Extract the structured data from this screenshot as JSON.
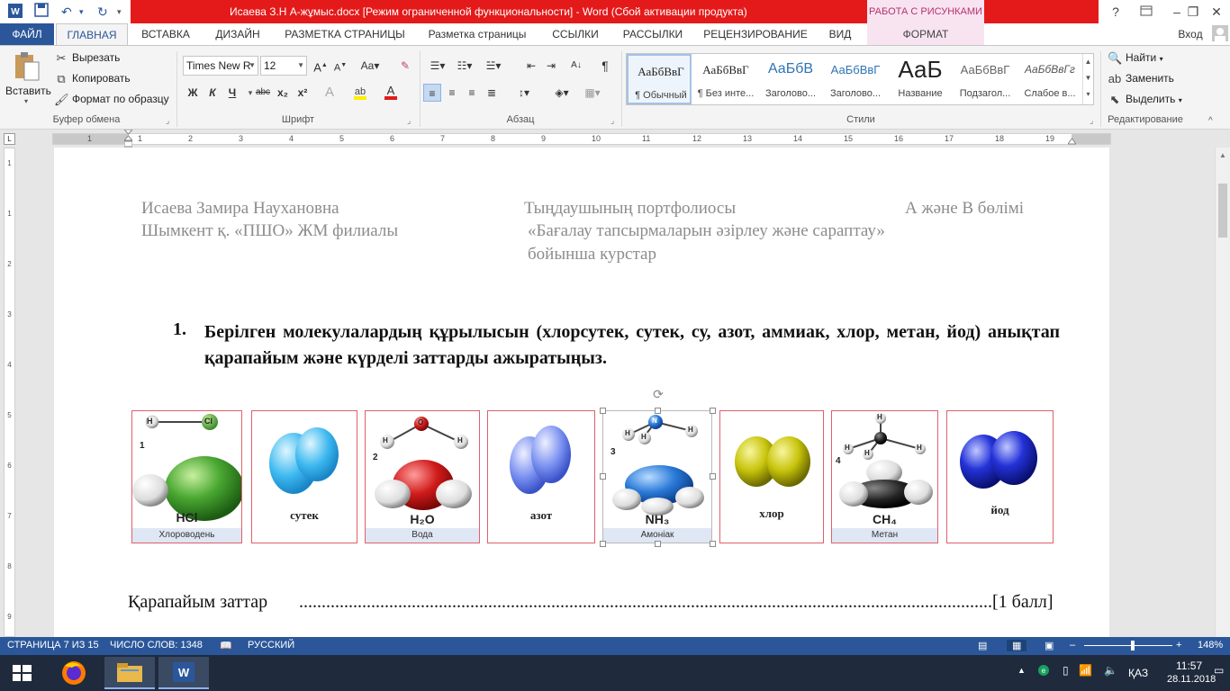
{
  "window": {
    "title": "Исаева З.Н   А-жұмыс.docx [Режим ограниченной функциональности]  -  Word (Сбой активации продукта)",
    "context_tab_group": "РАБОТА С РИСУНКАМИ",
    "help": "?",
    "accent_color": "#2b579a",
    "title_bg_color": "#e41a1a"
  },
  "tabs": {
    "file": "ФАЙЛ",
    "home": "ГЛАВНАЯ",
    "insert": "ВСТАВКА",
    "design": "ДИЗАЙН",
    "page_layout": "РАЗМЕТКА СТРАНИЦЫ",
    "page_layout2": "Разметка страницы",
    "references": "ССЫЛКИ",
    "mailings": "РАССЫЛКИ",
    "review": "РЕЦЕНЗИРОВАНИЕ",
    "view": "ВИД",
    "format": "ФОРМАТ",
    "signin": "Вход"
  },
  "ribbon": {
    "clipboard": {
      "paste": "Вставить",
      "cut": "Вырезать",
      "copy": "Копировать",
      "format_painter": "Формат по образцу",
      "label": "Буфер обмена"
    },
    "font": {
      "font_name": "Times New R",
      "font_size": "12",
      "bold": "Ж",
      "italic": "К",
      "underline": "Ч",
      "strike": "abc",
      "subscript": "x₂",
      "superscript": "x²",
      "label": "Шрифт"
    },
    "paragraph": {
      "label": "Абзац"
    },
    "styles": {
      "label": "Стили",
      "items": [
        {
          "sample": "АаБбВвГ",
          "name": "¶ Обычный"
        },
        {
          "sample": "АаБбВвГ",
          "name": "¶ Без инте..."
        },
        {
          "sample": "АаБбВ",
          "name": "Заголово..."
        },
        {
          "sample": "АаБбВвГ",
          "name": "Заголово..."
        },
        {
          "sample": "АаБ",
          "name": "Название"
        },
        {
          "sample": "АаБбВвГ",
          "name": "Подзагол..."
        },
        {
          "sample": "АаБбВвГг",
          "name": "Слабое в..."
        }
      ]
    },
    "editing": {
      "find": "Найти",
      "replace": "Заменить",
      "select": "Выделить",
      "label": "Редактирование"
    }
  },
  "ruler": {
    "h_numbers": [
      "1",
      "1",
      "2",
      "3",
      "4",
      "5",
      "6",
      "7",
      "8",
      "9",
      "10",
      "11",
      "12",
      "13",
      "14",
      "15",
      "16",
      "17",
      "18",
      "19"
    ],
    "v_numbers": [
      "1",
      "1",
      "2",
      "3",
      "4",
      "5",
      "6",
      "7",
      "8",
      "9"
    ]
  },
  "document": {
    "header": {
      "left_line1": "Исаева Замира Наухановна",
      "left_line2": "Шымкент қ. «ПШО» ЖМ филиалы",
      "center_line1": "Тыңдаушының портфолиосы",
      "center_line2": "«Бағалау тапсырмаларын әзірлеу және сараптау»",
      "center_line3": "бойынша курстар",
      "right_line1": "А және В бөлімі"
    },
    "question": {
      "number": "1.",
      "text": "Берілген молекулалардың құрылысын (хлорсутек, сутек, су, азот, аммиак, хлор, метан, йод) анықтап қарапайым және күрделі заттарды ажыратыңыз."
    },
    "molecules": [
      {
        "caption": "HCl",
        "subcaption": "Хлороводень",
        "number": "1",
        "atoms": [
          "H",
          "Cl"
        ]
      },
      {
        "caption": "сутек"
      },
      {
        "caption": "H₂O",
        "subcaption": "Вода",
        "number": "2",
        "atoms": [
          "H",
          "O",
          "H"
        ]
      },
      {
        "caption": "азот"
      },
      {
        "caption": "NH₃",
        "subcaption": "Амоніак",
        "number": "3",
        "atoms": [
          "N",
          "H",
          "H",
          "H"
        ]
      },
      {
        "caption": "хлор"
      },
      {
        "caption": "CH₄",
        "subcaption": "Метан",
        "number": "4",
        "atoms": [
          "H",
          "H",
          "H",
          "H"
        ]
      },
      {
        "caption": "йод"
      }
    ],
    "answer": {
      "label": "Қарапайым заттар",
      "dots": "..........................................................................................................................................................................",
      "points": "[1 балл]"
    }
  },
  "status": {
    "page": "СТРАНИЦА 7 ИЗ 15",
    "words": "ЧИСЛО СЛОВ: 1348",
    "language": "РУССКИЙ",
    "zoom": "148%"
  },
  "taskbar": {
    "keyboard": "ҚАЗ",
    "time": "11:57",
    "date": "28.11.2018"
  }
}
